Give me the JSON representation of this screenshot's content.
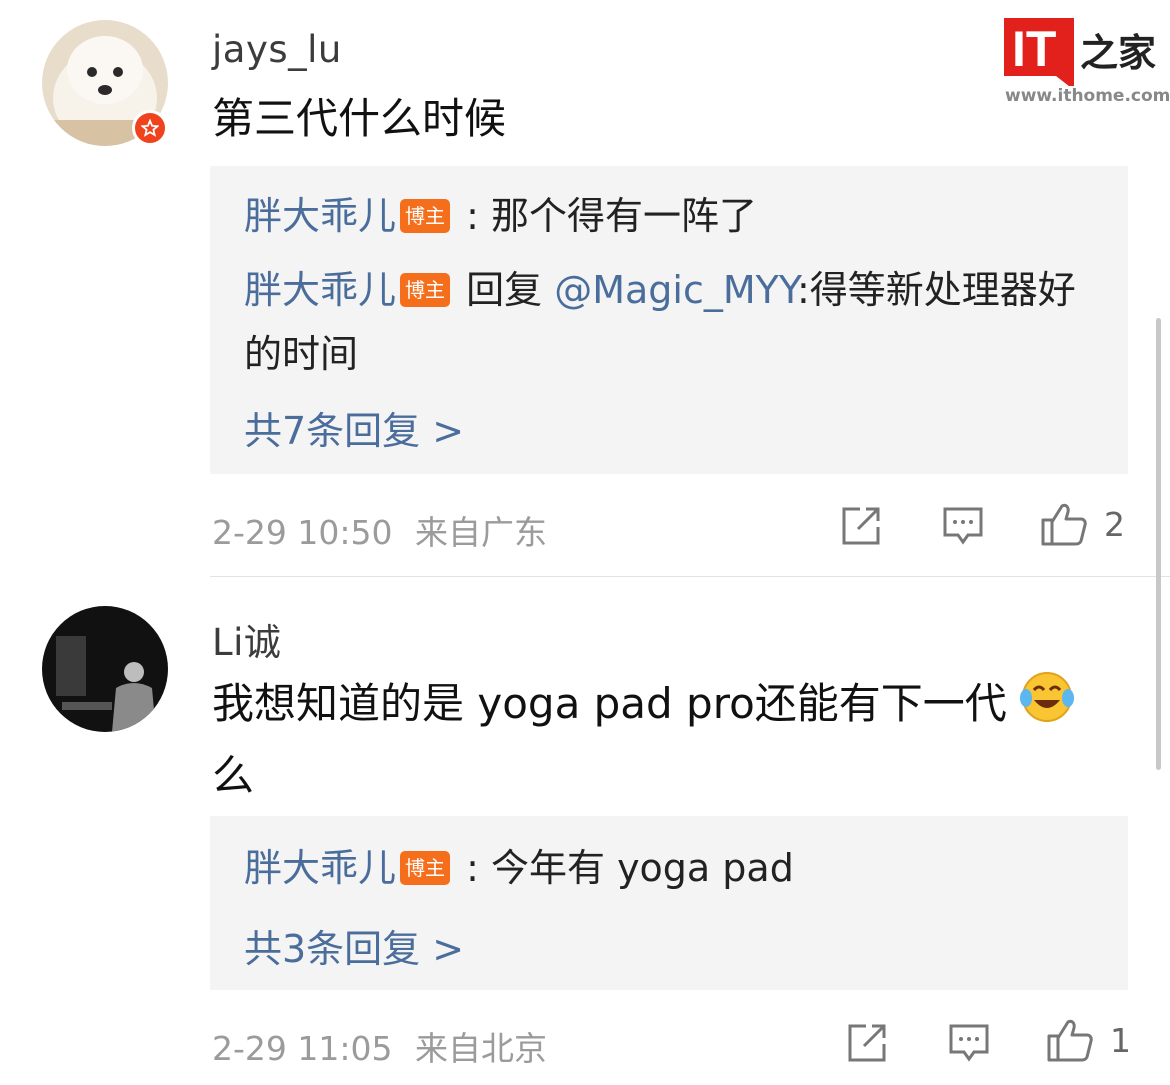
{
  "watermark": {
    "logo_text": "IT",
    "logo_chinese": "之家",
    "url": "www.ithome.com"
  },
  "comments": [
    {
      "username": "jays_lu",
      "text": "第三代什么时候",
      "verified": true,
      "replies": [
        {
          "author": "胖大乖儿",
          "tag": "博主",
          "sep": " : ",
          "text": "那个得有一阵了"
        },
        {
          "author": "胖大乖儿",
          "tag": "博主",
          "sep": " 回复 ",
          "mention": "@Magic_MYY",
          "text": ":得等新处理器好的时间"
        }
      ],
      "more_replies": "共7条回复 >",
      "time": "2-29 10:50",
      "location": "来自广东",
      "likes": "2"
    },
    {
      "username": "Li诚",
      "text": "我想知道的是 yoga pad pro还能有下一代",
      "text_tail": "么",
      "emoji": "laughing-tears-emoji",
      "verified": false,
      "replies": [
        {
          "author": "胖大乖儿",
          "tag": "博主",
          "sep": " : ",
          "text": "今年有 yoga pad"
        }
      ],
      "more_replies": "共3条回复 >",
      "time": "2-29 11:05",
      "location": "来自北京",
      "likes": "1"
    }
  ],
  "icons": {
    "share": "share-icon",
    "comment": "comment-icon",
    "like": "thumbs-up-icon"
  },
  "colors": {
    "link": "#4a6d9c",
    "tag": "#f56e1b",
    "badge": "#f0421c",
    "logo": "#e2211c"
  }
}
